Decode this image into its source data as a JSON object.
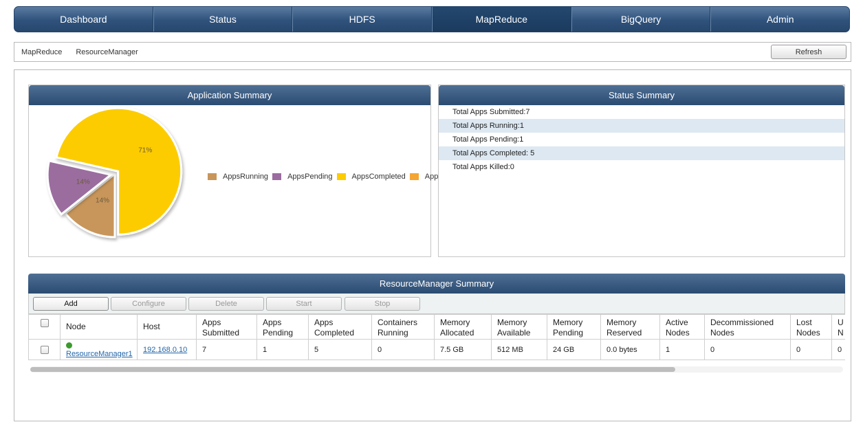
{
  "nav": {
    "tabs": [
      {
        "label": "Dashboard"
      },
      {
        "label": "Status"
      },
      {
        "label": "HDFS"
      },
      {
        "label": "MapReduce",
        "active": true
      },
      {
        "label": "BigQuery"
      },
      {
        "label": "Admin"
      }
    ]
  },
  "breadcrumb": {
    "items": [
      "MapReduce",
      "ResourceManager"
    ],
    "refresh_label": "Refresh"
  },
  "app_summary": {
    "title": "Application Summary",
    "legend": [
      "AppsRunning",
      "AppsPending",
      "AppsCompleted",
      "AppsKilled"
    ],
    "slice_labels": [
      "14%",
      "14%",
      "71%"
    ]
  },
  "chart_data": {
    "type": "pie",
    "categories": [
      "AppsRunning",
      "AppsPending",
      "AppsCompleted",
      "AppsKilled"
    ],
    "values": [
      1,
      1,
      5,
      0
    ],
    "labels": [
      "14%",
      "14%",
      "71%",
      ""
    ],
    "colors": [
      "#c8965a",
      "#9b6d9f",
      "#fccc00",
      "#f5a532"
    ],
    "legend_position": "right"
  },
  "status_summary": {
    "title": "Status Summary",
    "rows": [
      "Total Apps Submitted:7",
      "Total Apps Running:1",
      "Total Apps Pending:1",
      "Total Apps Completed: 5",
      "Total Apps Killed:0"
    ]
  },
  "rm_summary": {
    "title": "ResourceManager Summary",
    "toolbar": {
      "add": "Add",
      "configure": "Configure",
      "delete": "Delete",
      "start": "Start",
      "stop": "Stop"
    },
    "columns": {
      "node": "Node",
      "host": "Host",
      "apps_submitted": [
        "Apps",
        "Submitted"
      ],
      "apps_pending": [
        "Apps",
        "Pending"
      ],
      "apps_completed": [
        "Apps",
        "Completed"
      ],
      "containers_running": [
        "Containers",
        "Running"
      ],
      "memory_allocated": [
        "Memory",
        "Allocated"
      ],
      "memory_available": [
        "Memory",
        "Available"
      ],
      "memory_pending": [
        "Memory",
        "Pending"
      ],
      "memory_reserved": [
        "Memory",
        "Reserved"
      ],
      "active_nodes": [
        "Active",
        "Nodes"
      ],
      "decommissioned_nodes": [
        "Decommissioned",
        "Nodes"
      ],
      "lost_nodes": [
        "Lost",
        "Nodes"
      ],
      "unhealthy_nodes": [
        "U",
        "N"
      ]
    },
    "row": {
      "node": "ResourceManager1",
      "host": "192.168.0.10",
      "apps_submitted": "7",
      "apps_pending": "1",
      "apps_completed": "5",
      "containers_running": "0",
      "memory_allocated": "7.5 GB",
      "memory_available": "512 MB",
      "memory_pending": "24 GB",
      "memory_reserved": "0.0 bytes",
      "active_nodes": "1",
      "decommissioned_nodes": "0",
      "lost_nodes": "0",
      "unhealthy_nodes": "0"
    }
  },
  "colors": {
    "nav_bg": "#2f527c",
    "nav_active": "#1b3a5e",
    "row_alt": "#dde8f2",
    "link": "#2266aa"
  }
}
